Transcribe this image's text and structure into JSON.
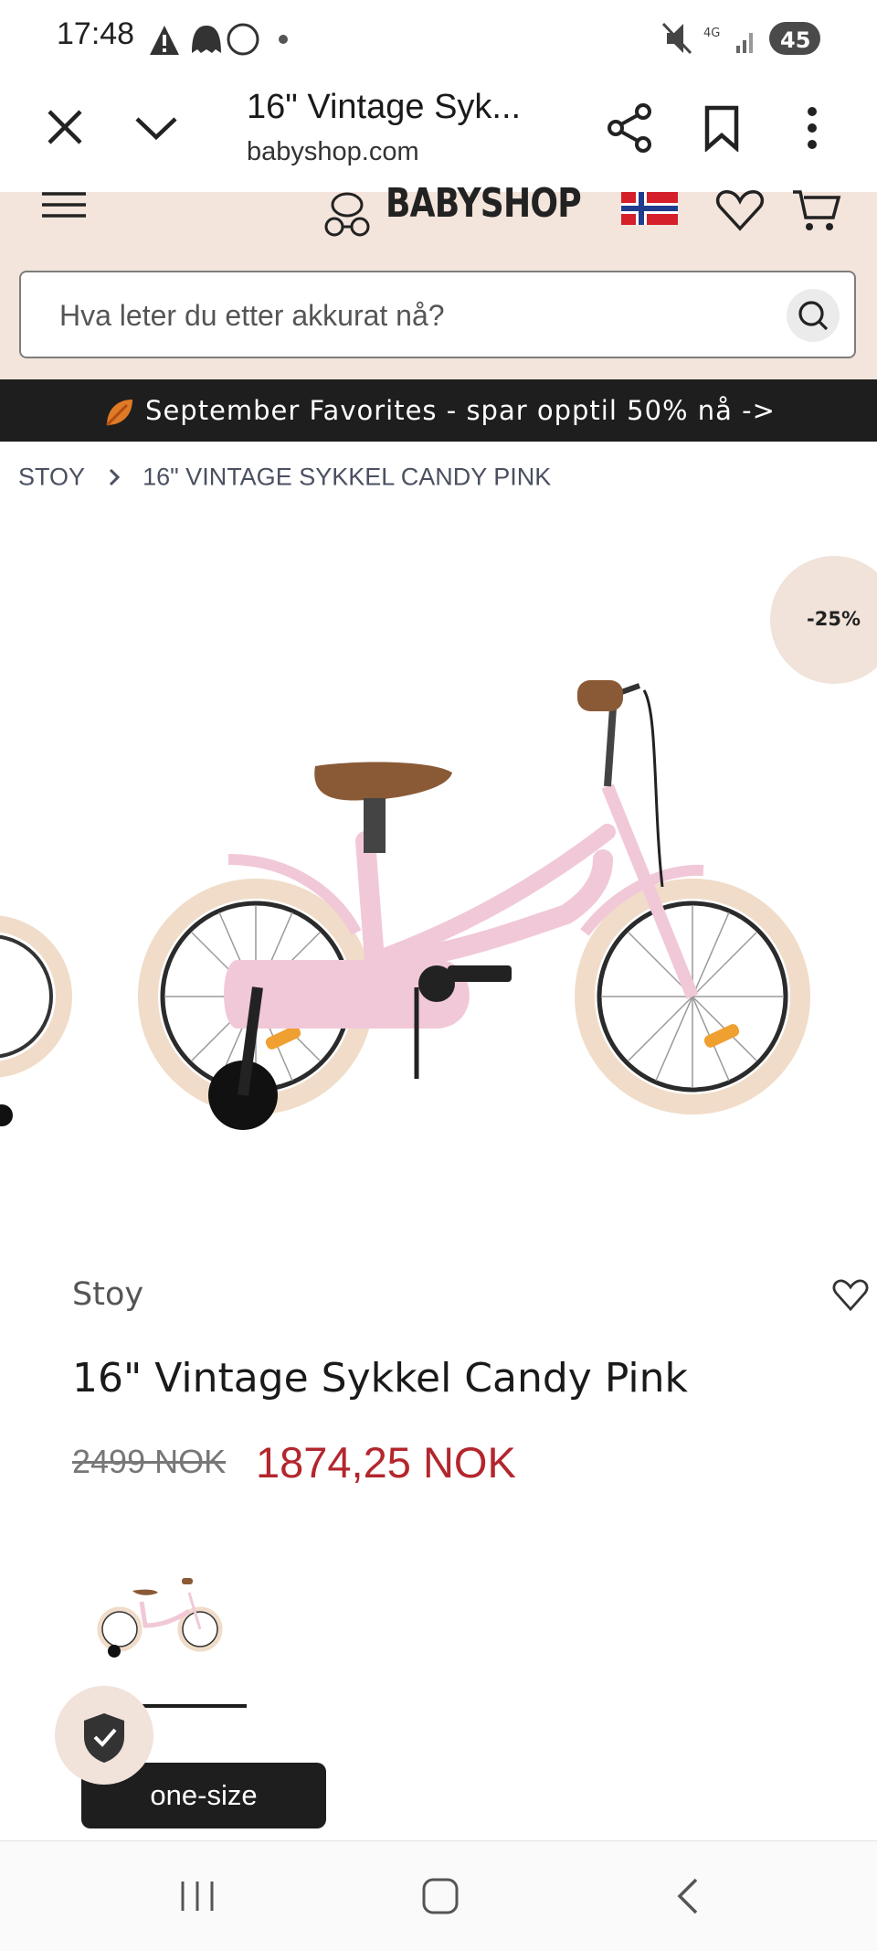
{
  "status_bar": {
    "time": "17:48",
    "battery": "45",
    "network": "4G"
  },
  "browser": {
    "tab_title": "16\" Vintage Syk...",
    "url": "babyshop.com"
  },
  "site": {
    "logo_text": "BABYSHOP",
    "search_placeholder": "Hva leter du etter akkurat nå?"
  },
  "promo": {
    "text": "September Favorites - spar opptil 50% nå ->"
  },
  "breadcrumb": {
    "items": [
      "STOY",
      "16\" VINTAGE SYKKEL CANDY PINK"
    ]
  },
  "product": {
    "discount_badge": "-25%",
    "brand": "Stoy",
    "title": "16\" Vintage Sykkel Candy Pink",
    "old_price": "2499 NOK",
    "new_price": "1874,25 NOK",
    "size_label": "one-size"
  },
  "colors": {
    "accent_price": "#b3262d",
    "header_bg": "#f3e4dc",
    "promo_bg": "#1e1e1e",
    "bike_pink": "#f1c8d8"
  }
}
